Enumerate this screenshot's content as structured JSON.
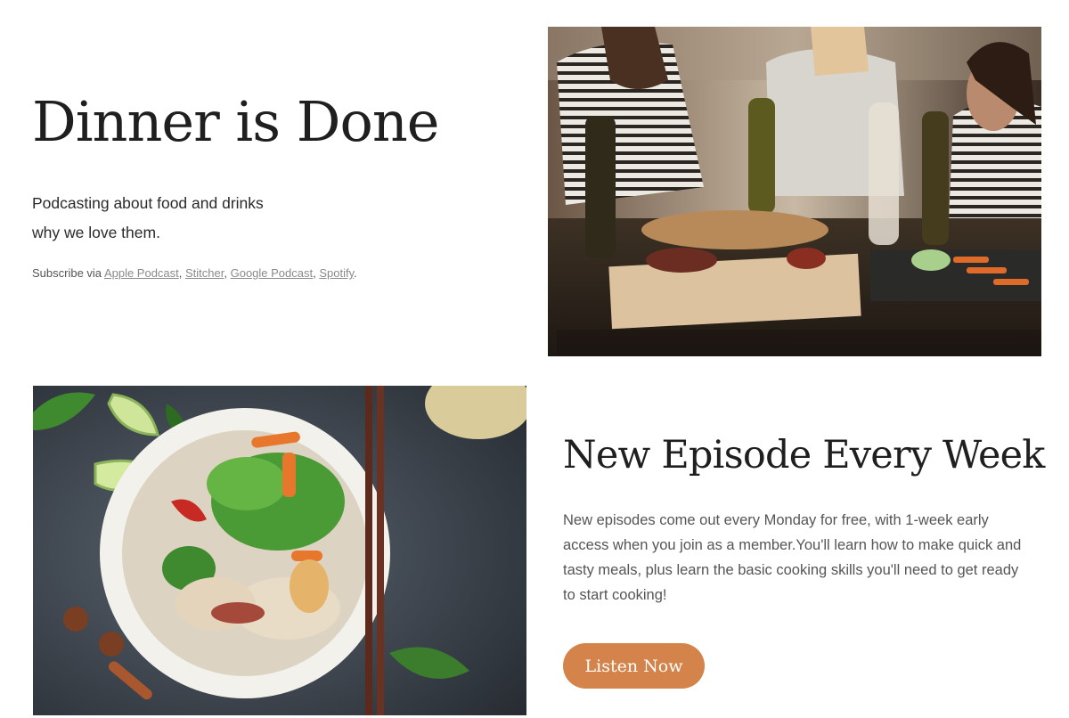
{
  "hero": {
    "title": "Dinner is Done",
    "tagline_line1": "Podcasting about food and drinks",
    "tagline_line2": "why we love them.",
    "subscribe_prefix": "Subscribe via ",
    "links": [
      "Apple Podcast",
      "Stitcher",
      "Google Podcast",
      "Spotify"
    ],
    "separator": ", ",
    "suffix": "."
  },
  "episodes": {
    "title": "New Episode Every Week",
    "description": "New episodes come out every Monday for free, with 1-week early access when you join as a member.You'll learn how to make quick and tasty meals, plus learn the basic cooking skills you'll need to get ready to start cooking!",
    "button_label": "Listen Now"
  },
  "colors": {
    "accent": "#d4844a",
    "text": "#1f1f1f",
    "muted": "#555555"
  }
}
